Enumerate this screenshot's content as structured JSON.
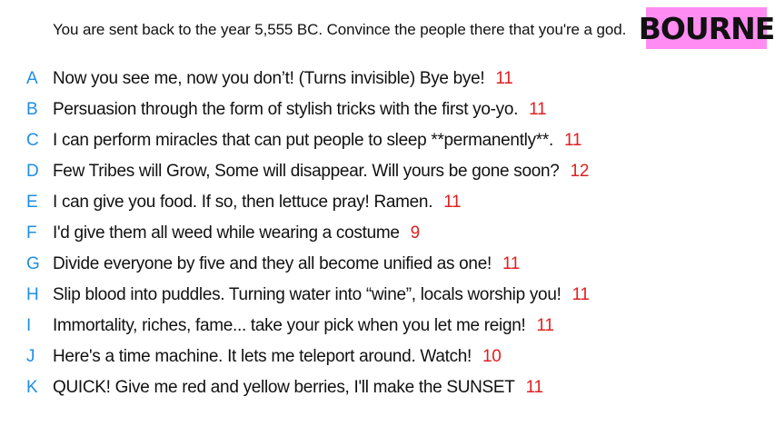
{
  "prompt": "You are sent back to the year 5,555 BC. Convince the people there that you're a god.",
  "player_name": "BOURNE",
  "answers": [
    {
      "letter": "A",
      "text": "Now you see me, now you don’t! (Turns invisible) Bye bye!",
      "score": "11"
    },
    {
      "letter": "B",
      "text": "Persuasion through the form of stylish tricks with the first yo-yo.",
      "score": "11"
    },
    {
      "letter": "C",
      "text": "I can perform miracles that can put people to sleep **permanently**.",
      "score": "11"
    },
    {
      "letter": "D",
      "text": "Few Tribes will Grow, Some will disappear. Will yours be gone soon?",
      "score": "12"
    },
    {
      "letter": "E",
      "text": "I can give you food. If so, then lettuce pray! Ramen.",
      "score": "11"
    },
    {
      "letter": "F",
      "text": "I'd give them all weed while wearing a costume",
      "score": "9"
    },
    {
      "letter": "G",
      "text": "Divide everyone by five and they all become unified as one!",
      "score": "11"
    },
    {
      "letter": "H",
      "text": "Slip blood into puddles. Turning water into “wine”, locals worship you!",
      "score": "11"
    },
    {
      "letter": "I",
      "text": "Immortality, riches, fame... take your pick when you let me reign!",
      "score": "11"
    },
    {
      "letter": "J",
      "text": "Here's a time machine. It lets me teleport around. Watch!",
      "score": "10"
    },
    {
      "letter": "K",
      "text": "QUICK! Give me red and yellow berries, I'll make the SUNSET",
      "score": "11"
    }
  ]
}
